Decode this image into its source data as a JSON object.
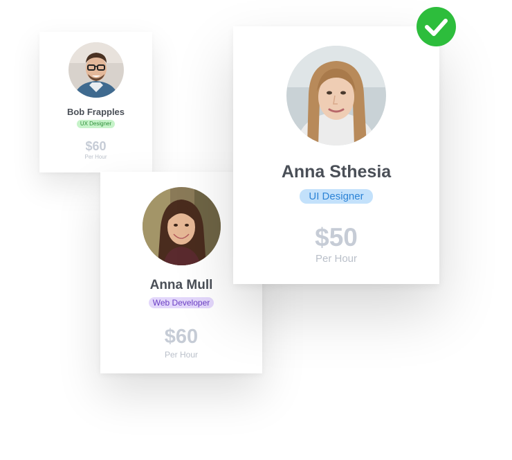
{
  "cards": [
    {
      "name": "Bob Frapples",
      "role": "UX Designer",
      "price": "$60",
      "unit": "Per Hour"
    },
    {
      "name": "Anna Mull",
      "role": "Web Developer",
      "price": "$60",
      "unit": "Per Hour"
    },
    {
      "name": "Anna Sthesia",
      "role": "UI Designer",
      "price": "$50",
      "unit": "Per Hour",
      "selected": true
    }
  ],
  "icons": {
    "selected": "checkmark-circle-icon"
  },
  "colors": {
    "check": "#2dbd3c",
    "ux_badge": "#c6f3c9",
    "web_badge": "#e3d7fb",
    "ui_badge": "#c3e1fb"
  }
}
